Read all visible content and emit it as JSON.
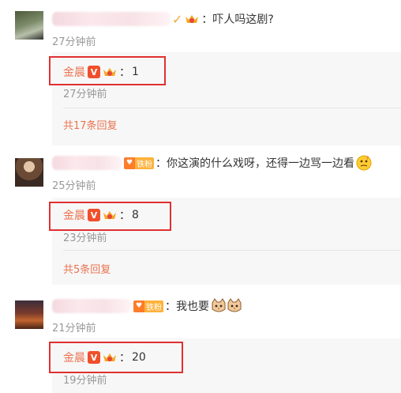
{
  "comments": [
    {
      "text": "：吓人吗这剧?",
      "time": "27分钟前",
      "reply": {
        "name": "金晨",
        "separator": "：",
        "value": "1",
        "time": "27分钟前"
      },
      "more": "共17条回复"
    },
    {
      "fan_badge": "铁粉",
      "text": "：你这演的什么戏呀，还得一边骂一边看",
      "time": "25分钟前",
      "reply": {
        "name": "金晨",
        "separator": "：",
        "value": "8",
        "time": "23分钟前"
      },
      "more": "共5条回复"
    },
    {
      "fan_badge": "铁粉",
      "text": "：我也要",
      "time": "21分钟前",
      "reply": {
        "name": "金晨",
        "separator": "：",
        "value": "20",
        "time": "19分钟前"
      }
    }
  ],
  "badges": {
    "verified_letter": "V"
  },
  "colors": {
    "highlight": "#e03030",
    "link": "#eb7350",
    "meta": "#999999",
    "reply_bg": "#f7f7f7"
  }
}
